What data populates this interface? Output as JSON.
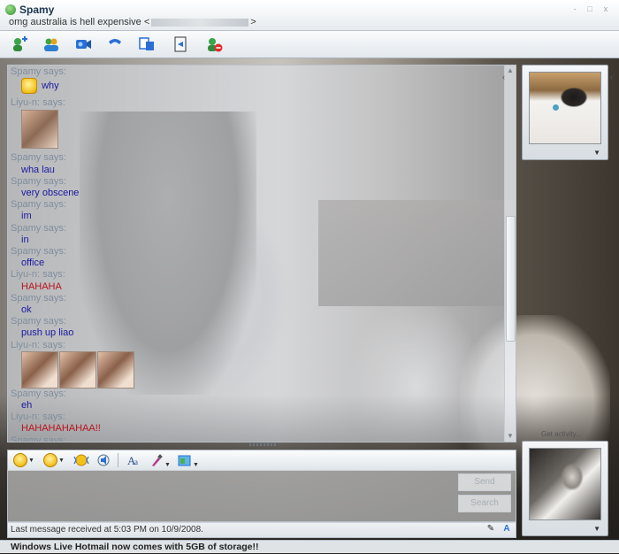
{
  "window": {
    "contact_name": "Spamy",
    "status_message": "omg australia is hell expensive <",
    "status_message_end": ">",
    "controls": [
      "-",
      "□",
      "x"
    ]
  },
  "toolbar": {
    "buttons": [
      {
        "name": "invite-contact",
        "icon": "add-contact-icon"
      },
      {
        "name": "share-files",
        "icon": "share-files-icon"
      },
      {
        "name": "video-call",
        "icon": "video-icon"
      },
      {
        "name": "call",
        "icon": "phone-icon"
      },
      {
        "name": "games",
        "icon": "games-icon"
      },
      {
        "name": "activities",
        "icon": "activities-icon"
      },
      {
        "name": "block",
        "icon": "block-contact-icon"
      }
    ]
  },
  "conversation": [
    {
      "speaker": "Spamy says:",
      "type": "emoticon",
      "text": "why"
    },
    {
      "speaker": "Liyu-n: says:",
      "type": "image",
      "text": ""
    },
    {
      "speaker": "Spamy says:",
      "type": "text",
      "text": "wha lau"
    },
    {
      "speaker": "Spamy says:",
      "type": "text",
      "text": "very obscene"
    },
    {
      "speaker": "Spamy says:",
      "type": "text",
      "text": "im"
    },
    {
      "speaker": "Spamy says:",
      "type": "text",
      "text": "in"
    },
    {
      "speaker": "Spamy says:",
      "type": "text",
      "text": "office"
    },
    {
      "speaker": "Liyu-n: says:",
      "type": "text-red",
      "text": "HAHAHA"
    },
    {
      "speaker": "Spamy says:",
      "type": "text",
      "text": "ok"
    },
    {
      "speaker": "Spamy says:",
      "type": "text",
      "text": "push up liao"
    },
    {
      "speaker": "Liyu-n: says:",
      "type": "images3",
      "text": ""
    },
    {
      "speaker": "Spamy says:",
      "type": "text",
      "text": "eh"
    },
    {
      "speaker": "Liyu-n: says:",
      "type": "text-red",
      "text": "HAHAHAHAHAA!!"
    },
    {
      "speaker": "Spamy says:",
      "type": "text",
      "text": ":)"
    }
  ],
  "compose": {
    "send_label": "Send",
    "search_label": "Search"
  },
  "status": {
    "last_message": "Last message received at 5:03 PM on 10/9/2008."
  },
  "ad": {
    "text": "Windows Live Hotmail now comes with 5GB of storage!!"
  },
  "side": {
    "label": "Get activity..."
  },
  "colors": {
    "sender_text": "#1a1aa0",
    "receiver_text": "#b8141c",
    "says_text": "#7e8e9e"
  }
}
